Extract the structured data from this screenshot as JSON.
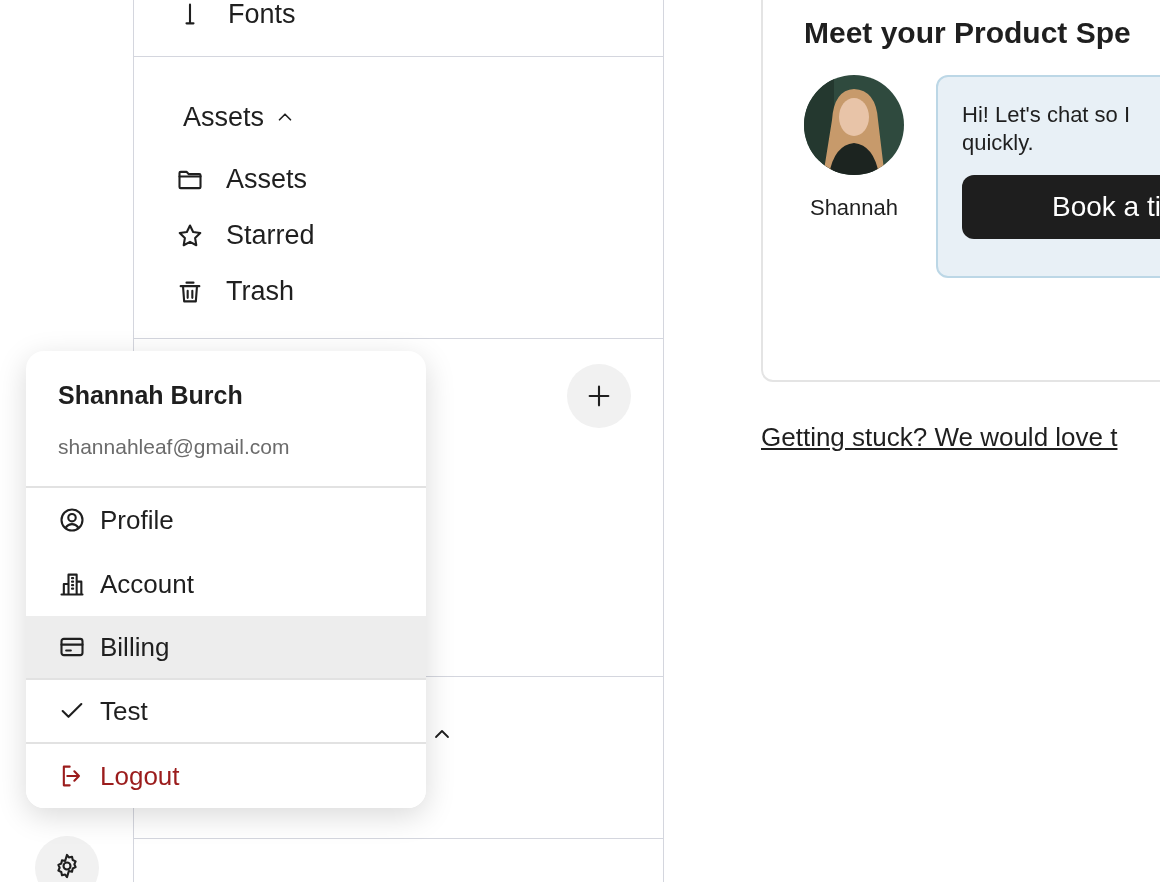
{
  "sidebar": {
    "top_item": {
      "label": "Fonts"
    },
    "assets_section": {
      "title": "Assets",
      "expanded": true,
      "items": [
        {
          "label": "Assets"
        },
        {
          "label": "Starred"
        },
        {
          "label": "Trash"
        }
      ]
    }
  },
  "user_menu": {
    "name": "Shannah Burch",
    "email": "shannahleaf@gmail.com",
    "items": [
      {
        "kind": "link",
        "label": "Profile",
        "selected": false
      },
      {
        "kind": "link",
        "label": "Account",
        "selected": false
      },
      {
        "kind": "link",
        "label": "Billing",
        "selected": true
      },
      {
        "kind": "toggle",
        "label": "Test",
        "checked": true,
        "selected": false
      },
      {
        "kind": "danger",
        "label": "Logout",
        "selected": false
      }
    ]
  },
  "specialist_card": {
    "title": "Meet your Product Spe",
    "person": "Shannah",
    "message": "Hi! Let's chat so I\nquickly.",
    "button": "Book a ti"
  },
  "help_link": "Getting stuck? We would love t"
}
